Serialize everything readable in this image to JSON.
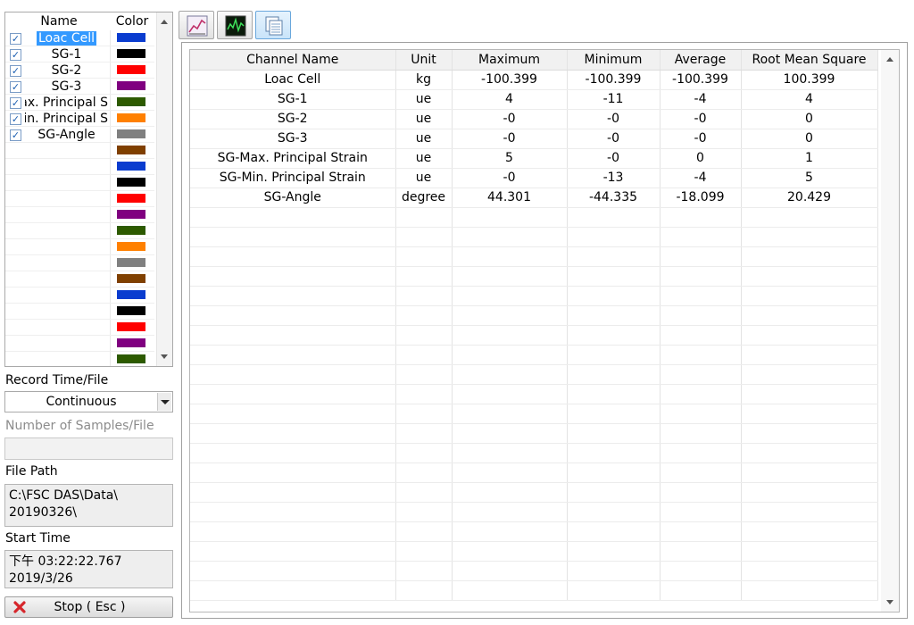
{
  "channel_list": {
    "header_name": "Name",
    "header_color": "Color",
    "channels": [
      {
        "label": "Loac Cell",
        "checked": true,
        "selected": true
      },
      {
        "label": "SG-1",
        "checked": true
      },
      {
        "label": "SG-2",
        "checked": true
      },
      {
        "label": "SG-3",
        "checked": true
      },
      {
        "label": "ax. Principal S",
        "checked": true,
        "clipped": true
      },
      {
        "label": "lin. Principal S",
        "checked": true,
        "clipped": true
      },
      {
        "label": "SG-Angle",
        "checked": true
      }
    ],
    "swatch_colors": [
      "#0a3ccf",
      "#000000",
      "#ff0000",
      "#800080",
      "#2d5a00",
      "#ff8000",
      "#808080",
      "#804000",
      "#0a3ccf",
      "#000000",
      "#ff0000",
      "#800080",
      "#2d5a00",
      "#ff8000",
      "#808080",
      "#804000",
      "#0a3ccf",
      "#000000",
      "#ff0000",
      "#800080",
      "#2d5a00"
    ]
  },
  "record": {
    "label": "Record Time/File",
    "value": "Continuous"
  },
  "samples": {
    "label": "Number of Samples/File",
    "value": ""
  },
  "file_path": {
    "label": "File Path",
    "line1": "C:\\FSC DAS\\Data\\",
    "line2": "20190326\\"
  },
  "start_time": {
    "label": "Start Time",
    "line1": "下午 03:22:22.767",
    "line2": "2019/3/26"
  },
  "stop_button": {
    "label": "Stop ( Esc )"
  },
  "toolbar": {
    "icons": [
      "chart-icon",
      "oscilloscope-icon",
      "table-view-icon"
    ]
  },
  "table": {
    "columns": [
      "Channel Name",
      "Unit",
      "Maximum",
      "Minimum",
      "Average",
      "Root Mean Square"
    ],
    "rows": [
      [
        "Loac Cell",
        "kg",
        "-100.399",
        "-100.399",
        "-100.399",
        "100.399"
      ],
      [
        "SG-1",
        "ue",
        "4",
        "-11",
        "-4",
        "4"
      ],
      [
        "SG-2",
        "ue",
        "-0",
        "-0",
        "-0",
        "0"
      ],
      [
        "SG-3",
        "ue",
        "-0",
        "-0",
        "-0",
        "0"
      ],
      [
        "SG-Max. Principal Strain",
        "ue",
        "5",
        "-0",
        "0",
        "1"
      ],
      [
        "SG-Min. Principal Strain",
        "ue",
        "-0",
        "-13",
        "-4",
        "5"
      ],
      [
        "SG-Angle",
        "degree",
        "44.301",
        "-44.335",
        "-18.099",
        "20.429"
      ]
    ]
  }
}
